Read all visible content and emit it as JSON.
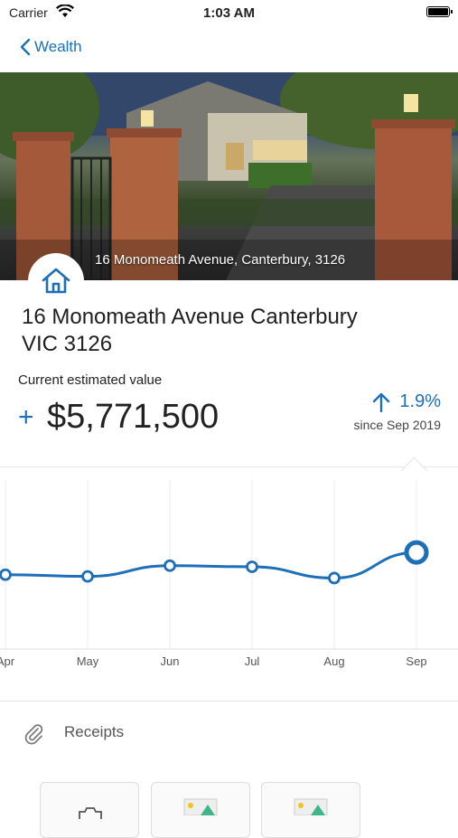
{
  "status": {
    "carrier": "Carrier",
    "time": "1:03 AM"
  },
  "nav": {
    "back_label": "Wealth"
  },
  "hero": {
    "caption": "16 Monomeath Avenue, Canterbury, 3126"
  },
  "property": {
    "title_line1": "16 Monomeath Avenue Canterbury",
    "title_line2": "VIC 3126",
    "estimate_label": "Current estimated value",
    "sign": "+",
    "value": "$5,771,500",
    "change_percent": "1.9%",
    "since": "since Sep 2019"
  },
  "chart_data": {
    "type": "line",
    "categories": [
      "Apr",
      "May",
      "Jun",
      "Jul",
      "Aug",
      "Sep"
    ],
    "values": [
      5.732,
      5.729,
      5.748,
      5.746,
      5.726,
      5.7715
    ],
    "highlight_index": 5,
    "accent": "#1c6fb8"
  },
  "receipts": {
    "label": "Receipts"
  },
  "colors": {
    "accent": "#1c6fb8"
  },
  "icons": [
    "chevron-left-icon",
    "wifi-icon",
    "battery-icon",
    "home-icon",
    "arrow-up-icon",
    "paperclip-icon",
    "camera-icon",
    "image-icon"
  ]
}
